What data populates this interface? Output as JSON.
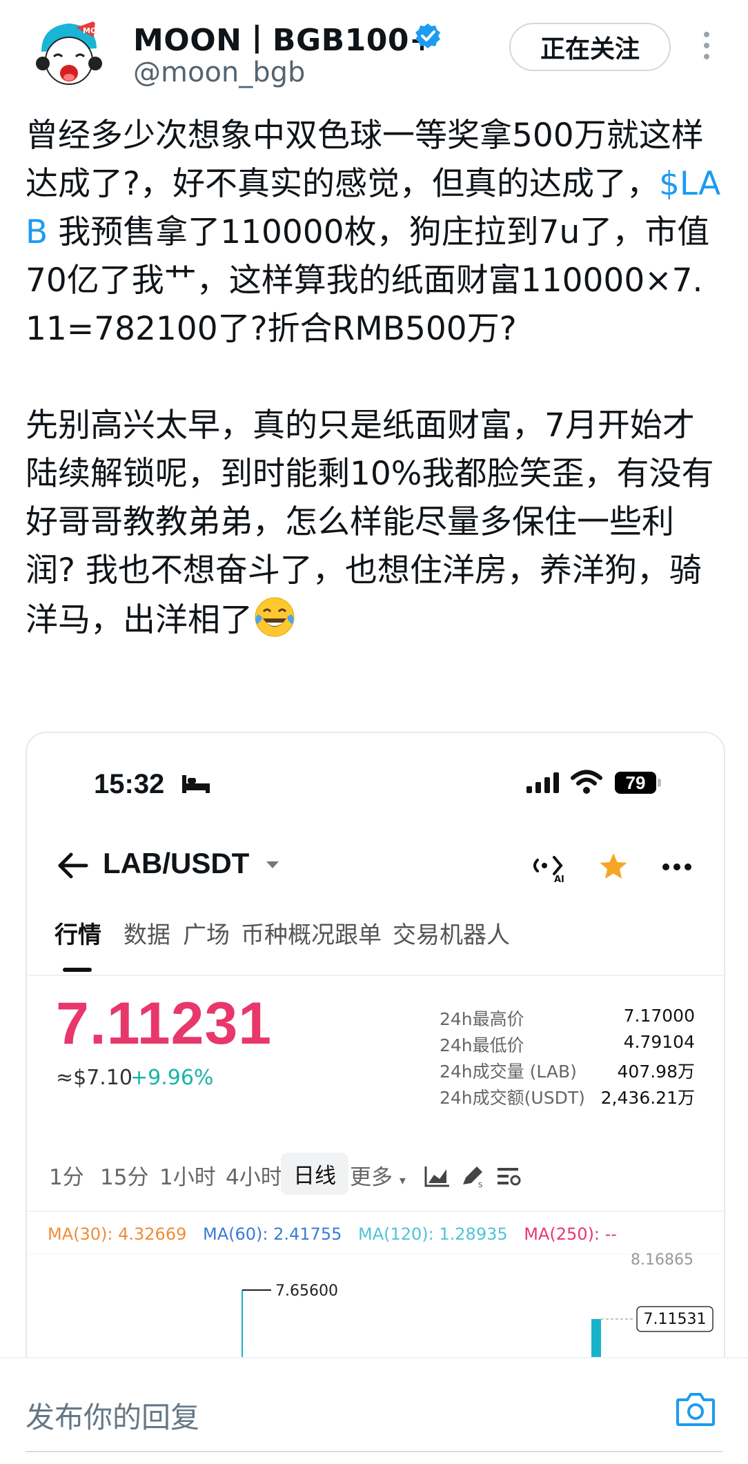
{
  "header": {
    "display_name": "MOON丨BGB100+",
    "handle": "@moon_bgb",
    "follow_button": "正在关注",
    "verified": true,
    "accent_color": "#1d9bf0"
  },
  "tweet": {
    "para1_before": "曾经多少次想象中双色球一等奖拿500万就这样达成了?，好不真实的感觉，但真的达成了，",
    "cashtag": "$LAB",
    "para1_after": " 我预售拿了110000枚，狗庄拉到7u了，市值70亿了我艹，这样算我的纸面财富110000×7.11=782100了?折合RMB500万?",
    "para2": "先别高兴太早，真的只是纸面财富，7月开始才陆续解锁呢，到时能剩10%我都脸笑歪，有没有好哥哥教教弟弟，怎么样能尽量多保住一些利润? 我也不想奋斗了，也想住洋房，养洋狗，骑洋马，出洋相了",
    "emoji": "face-with-tears-of-joy"
  },
  "screenshot": {
    "status_time": "15:32",
    "battery": "79",
    "pair": "LAB/USDT",
    "tabs": [
      "行情",
      "数据",
      "广场",
      "币种概况",
      "跟单",
      "交易机器人"
    ],
    "active_tab": "行情",
    "price": "7.11231",
    "usd_price": "≈$7.10",
    "change": "+9.96%",
    "stats": [
      {
        "label": "24h最高价",
        "value": "7.17000"
      },
      {
        "label": "24h最低价",
        "value": "4.79104"
      },
      {
        "label": "24h成交量 (LAB)",
        "value": "407.98万"
      },
      {
        "label": "24h成交额(USDT)",
        "value": "2,436.21万"
      }
    ],
    "periods": [
      "1分",
      "15分",
      "1小时",
      "4小时",
      "日线",
      "更多"
    ],
    "active_period": "日线",
    "ma": [
      {
        "label": "MA(30): 4.32669",
        "color": "#f08c3a"
      },
      {
        "label": "MA(60): 2.41755",
        "color": "#3a7bd5"
      },
      {
        "label": "MA(120): 1.28935",
        "color": "#4fc3d8"
      },
      {
        "label": "MA(250): --",
        "color": "#e8376b"
      }
    ],
    "chart_top_label": "8.16865",
    "high_marker": "7.65600",
    "current_marker": "7.11531",
    "up_color": "#19b3c9",
    "down_color": "#e8376b"
  },
  "reply": {
    "placeholder": "发布你的回复"
  }
}
